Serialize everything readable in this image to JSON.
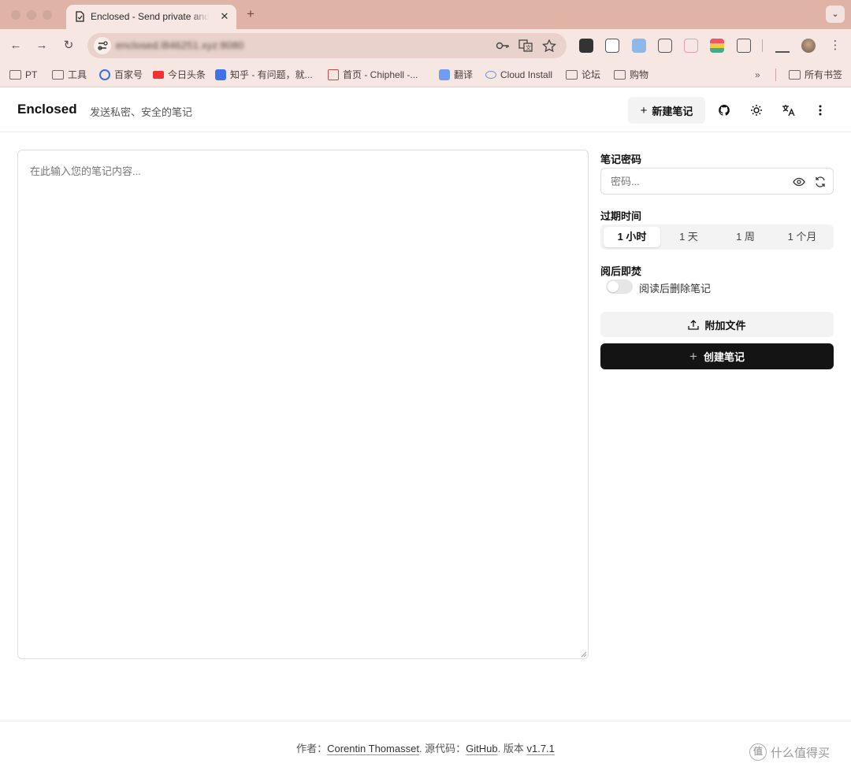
{
  "browser": {
    "tab_title": "Enclosed - Send private and secure notes",
    "url": "enclosed.l846251.xyz:8080",
    "bookmarks": [
      {
        "label": "PT",
        "icon": "folder-icon"
      },
      {
        "label": "工具",
        "icon": "folder-icon"
      },
      {
        "label": "百家号",
        "icon": "baijiahao-icon"
      },
      {
        "label": "今日头条",
        "icon": "toutiao-icon"
      },
      {
        "label": "知乎 - 有问题，就...",
        "icon": "zhihu-icon"
      },
      {
        "label": "首页 - Chiphell -...",
        "icon": "chiphell-icon"
      },
      {
        "label": "翻译",
        "icon": "translate-icon"
      },
      {
        "label": "Cloud Install",
        "icon": "cloud-icon"
      },
      {
        "label": "论坛",
        "icon": "folder-icon"
      },
      {
        "label": "购物",
        "icon": "folder-icon"
      }
    ],
    "more_bookmarks": "»",
    "all_bookmarks": "所有书签"
  },
  "header": {
    "brand": "Enclosed",
    "tagline": "发送私密、安全的笔记",
    "new_note": "新建笔记"
  },
  "editor": {
    "placeholder": "在此输入您的笔记内容..."
  },
  "sidebar": {
    "password_label": "笔记密码",
    "password_placeholder": "密码...",
    "expiry_label": "过期时间",
    "expiry_options": [
      "1 小时",
      "1 天",
      "1 周",
      "1 个月"
    ],
    "expiry_selected": "1 小时",
    "burn_label": "阅后即焚",
    "burn_toggle_text": "阅读后删除笔记",
    "attach_button": "附加文件",
    "create_button": "创建笔记"
  },
  "footer": {
    "author_prefix": "作者：",
    "author": "Corentin Thomasset",
    "source_prefix": ". 源代码：",
    "source": "GitHub",
    "version_prefix": ". 版本 ",
    "version": "v1.7.1"
  },
  "watermark": {
    "badge": "值",
    "text": "什么值得买"
  },
  "colors": {
    "chrome": "#dfb3a6",
    "toolbar": "#f6e7e2",
    "primary_button": "#141414"
  }
}
